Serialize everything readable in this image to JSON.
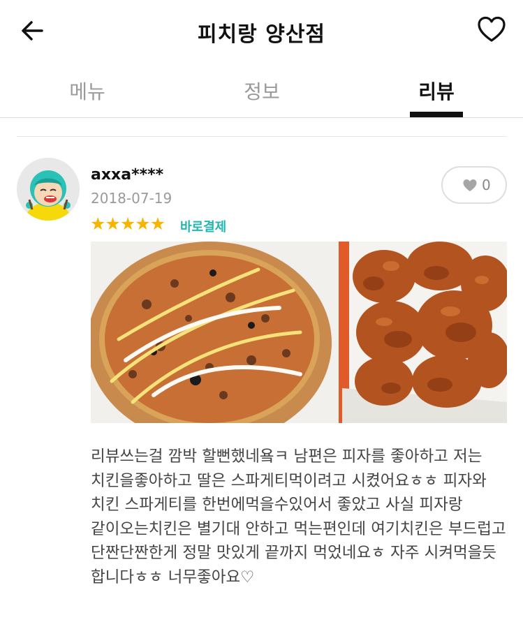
{
  "header": {
    "title": "피치랑 양산점",
    "back_icon": "arrow-left-icon",
    "favorite_icon": "heart-outline-icon"
  },
  "tabs": [
    {
      "label": "메뉴",
      "active": false
    },
    {
      "label": "정보",
      "active": false
    },
    {
      "label": "리뷰",
      "active": true
    }
  ],
  "review": {
    "username": "axxa****",
    "date": "2018-07-19",
    "rating": 5,
    "badge": "바로결제",
    "likes": "0",
    "photo_description": "pizza and chicken",
    "text": "리뷰쓰는걸 깜박 할뻔했네욬ㅋ 남편은 피자를 좋아하고 저는 치킨을좋아하고 딸은 스파게티먹이려고 시켰어요ㅎㅎ 피자와 치킨 스파게티를 한번에먹을수있어서 좋았고 사실 피자랑 같이오는치킨은 별기대 안하고 먹는편인데 여기치킨은 부드럽고 단짠단짠한게 정말 맛있게 끝까지 먹었네요ㅎ 자주 시켜먹을듯 합니다ㅎㅎ 너무좋아요♡"
  },
  "colors": {
    "accent_teal": "#22b6b0",
    "star_yellow": "#f7b500",
    "muted_gray": "#9a9a9a"
  }
}
